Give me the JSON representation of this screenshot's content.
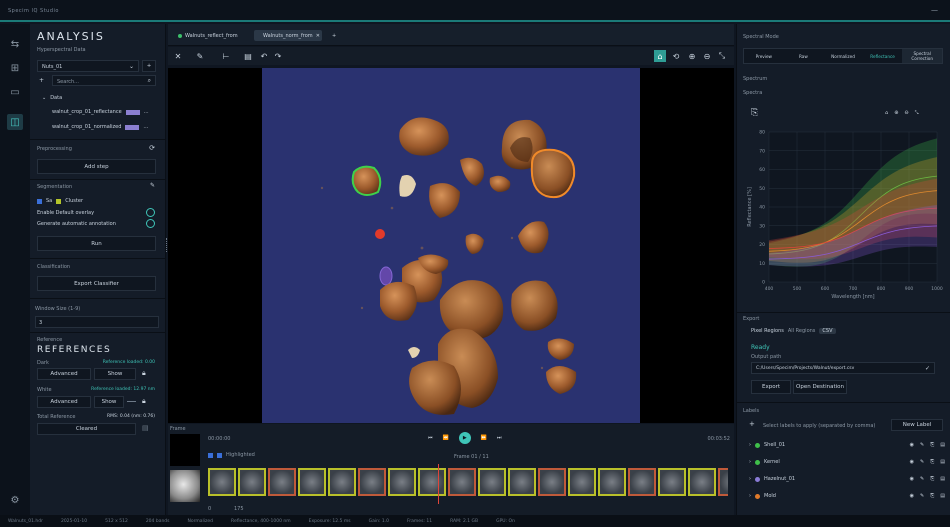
{
  "window": {
    "title": "Specim IQ Studio",
    "min_icon": "minimize-icon"
  },
  "rail": {
    "icons": [
      "link-icon",
      "grid-icon",
      "video-icon",
      "analysis-icon",
      "settings-icon"
    ]
  },
  "left": {
    "title": "ANALYSIS",
    "dataset_label": "Hyperspectral Data",
    "dataset_value": "Nuts_01",
    "search_placeholder": "Search...",
    "tree_header": "Data",
    "tree_items": [
      "walnut_crop_01_reflectance",
      "walnut_crop_01_normalized"
    ],
    "preprocessing_label": "Preprocessing",
    "add_button": "Add step",
    "segmentation_label": "Segmentation",
    "seg_chips": [
      "Sa",
      "Cluster"
    ],
    "seg_options": [
      "Enable Default overlay",
      "Generate automatic annotation"
    ],
    "run_button": "Run",
    "export_label": "Classification",
    "export_button": "Export Classifier",
    "window_label": "Window Size (1-9)",
    "window_value": "3",
    "refs_label": "Reference",
    "refs_title": "REFERENCES",
    "ref_rows": [
      {
        "label": "Dark",
        "status": "Reference loaded: 0.00",
        "buttons": [
          "Advanced",
          "Show"
        ]
      },
      {
        "label": "White",
        "status": "Reference loaded: 12.97 nm",
        "buttons": [
          "Advanced",
          "Show"
        ]
      },
      {
        "label": "Total Reference",
        "status": "RMS: 0.04 (nm: 0.76)",
        "buttons": [
          "Cleared"
        ]
      }
    ]
  },
  "center": {
    "tabs": [
      {
        "label": "Walnuts_reflect_from",
        "active": false
      },
      {
        "label": "Walnuts_norm_from",
        "active": true
      }
    ],
    "toolbar_left": [
      "cursor-icon",
      "pen-icon",
      "line-icon",
      "trash-icon",
      "undo-icon",
      "redo-icon"
    ],
    "toolbar_right": [
      "home-icon",
      "rotate-icon",
      "zoom-in-icon",
      "zoom-out-icon",
      "fit-icon"
    ],
    "timeline": {
      "frame_label": "Frame",
      "time_label": "00:00:00",
      "end_label": "00:03:52",
      "legend_prefix": "Highlighted",
      "position": "Frame 01 / 11",
      "thumb_count": 18,
      "axis_start": "0",
      "axis_end": "175"
    }
  },
  "right": {
    "spectral_label": "Spectral Mode",
    "mode_tabs": [
      "Preview",
      "Raw",
      "Normalized",
      "Reflectance",
      "Spectral Correction"
    ],
    "spectrum_label": "Spectrum",
    "spectrum_sub": "Spectra",
    "chart_ylabel": "Reflectance [%]",
    "chart_xlabel": "Wavelength [nm]",
    "chart_yticks": [
      "80",
      "70",
      "60",
      "50",
      "40",
      "30",
      "20",
      "10",
      "0"
    ],
    "chart_xticks": [
      "400",
      "500",
      "600",
      "700",
      "800",
      "900",
      "1000"
    ],
    "export_section": "Export",
    "file_label": "Pixel Regions",
    "file_value": "All Regions",
    "file_tag": "CSV",
    "output_label": "Output path",
    "output_value": "C:/Users/Specim/Projects/Walnut/export.csv",
    "action_buttons": [
      "Export",
      "Open Destination"
    ],
    "labels_label": "Labels",
    "labels_search": "Select labels to apply (separated by comma)",
    "new_label_btn": "New Label",
    "label_rows": [
      {
        "name": "Shell_01",
        "color": "#3fbf4a"
      },
      {
        "name": "Kernel",
        "color": "#3fbf4a"
      },
      {
        "name": "Hazelnut_01",
        "color": "#8a7bd6"
      },
      {
        "name": "Mold",
        "color": "#e07a2a"
      }
    ]
  },
  "status": {
    "items": [
      "Walnuts_01.hdr",
      "2025-01-10",
      "512 x 512",
      "204 bands",
      "Normalized",
      "Reflectance, 400-1000 nm",
      "Exposure: 12.5 ms",
      "Gain: 1.0",
      "Frames: 11",
      "RAM: 2.1 GB",
      "GPU: On"
    ]
  }
}
